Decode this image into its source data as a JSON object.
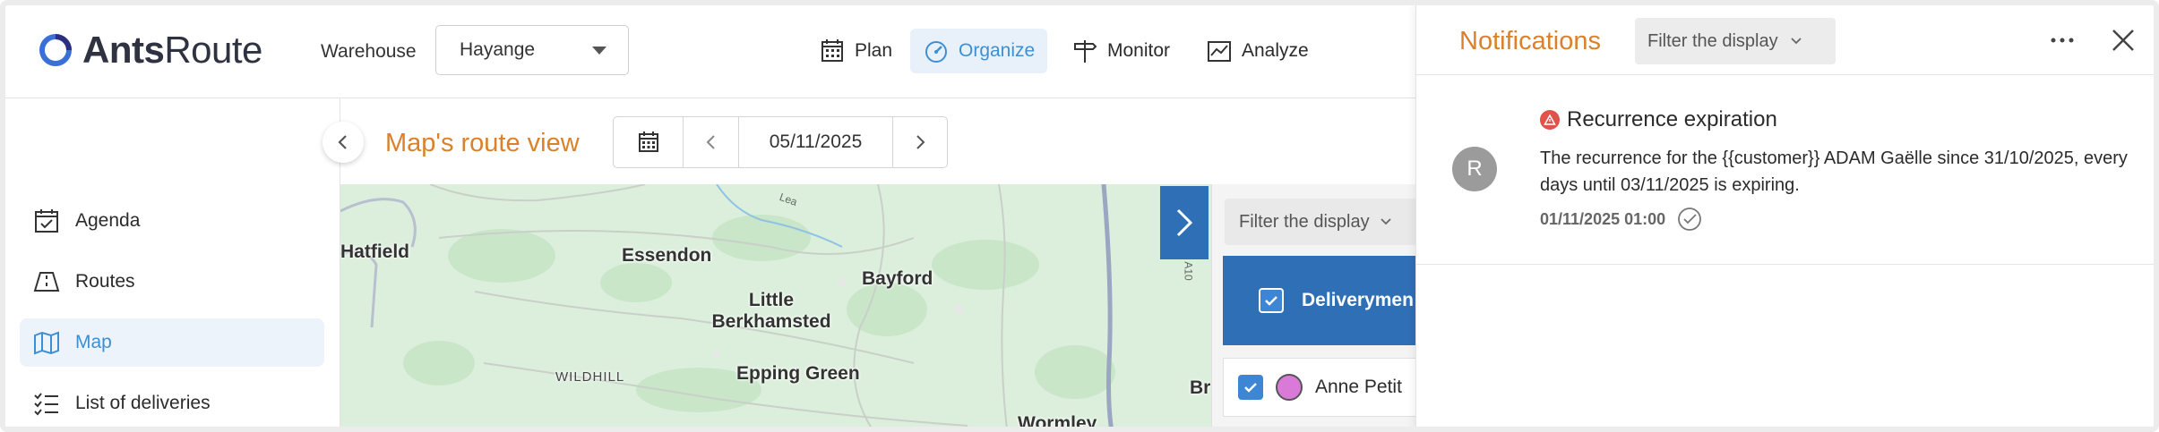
{
  "app": {
    "logo_bold": "Ants",
    "logo_rest": "Route"
  },
  "header": {
    "warehouse_label": "Warehouse",
    "warehouse_value": "Hayange",
    "nav": [
      {
        "label": "Plan",
        "icon": "calendar-icon",
        "active": false
      },
      {
        "label": "Organize",
        "icon": "gauge-icon",
        "active": true
      },
      {
        "label": "Monitor",
        "icon": "signpost-icon",
        "active": false
      },
      {
        "label": "Analyze",
        "icon": "chart-icon",
        "active": false
      }
    ]
  },
  "sidebar": {
    "items": [
      {
        "label": "Agenda",
        "icon": "calendar-check-icon",
        "active": false
      },
      {
        "label": "Routes",
        "icon": "route-icon",
        "active": false
      },
      {
        "label": "Map",
        "icon": "map-icon",
        "active": true
      },
      {
        "label": "List of deliveries",
        "icon": "list-check-icon",
        "active": false
      }
    ]
  },
  "main": {
    "title": "Map's route view",
    "date": "05/11/2025"
  },
  "map": {
    "places": {
      "hatfield": "Hatfield",
      "essendon": "Essendon",
      "bayford": "Bayford",
      "little_berkhamsted": "Little Berkhamsted",
      "wildhill": "WILDHILL",
      "epping_green": "Epping Green",
      "wormley": "Wormley",
      "br": "Br"
    },
    "roads": {
      "lea": "Lea",
      "a10": "A10"
    }
  },
  "delivery_panel": {
    "filter_label": "Filter the display",
    "group_label": "Deliverymen",
    "rows": [
      {
        "label": "Anne Petit",
        "color": "#da7ad8"
      }
    ]
  },
  "notifications": {
    "title": "Notifications",
    "filter_label": "Filter the display",
    "items": [
      {
        "avatar": "R",
        "title": "Recurrence expiration",
        "body": "The recurrence for the {{customer}} ADAM Gaëlle since 31/10/2025, every days until 03/11/2025 is expiring.",
        "timestamp": "01/11/2025 01:00"
      }
    ]
  },
  "colors": {
    "accent": "#3e8fd1",
    "title_orange": "#d9822b",
    "panel_blue": "#2f6fb6",
    "warning_red": "#e1524a"
  }
}
